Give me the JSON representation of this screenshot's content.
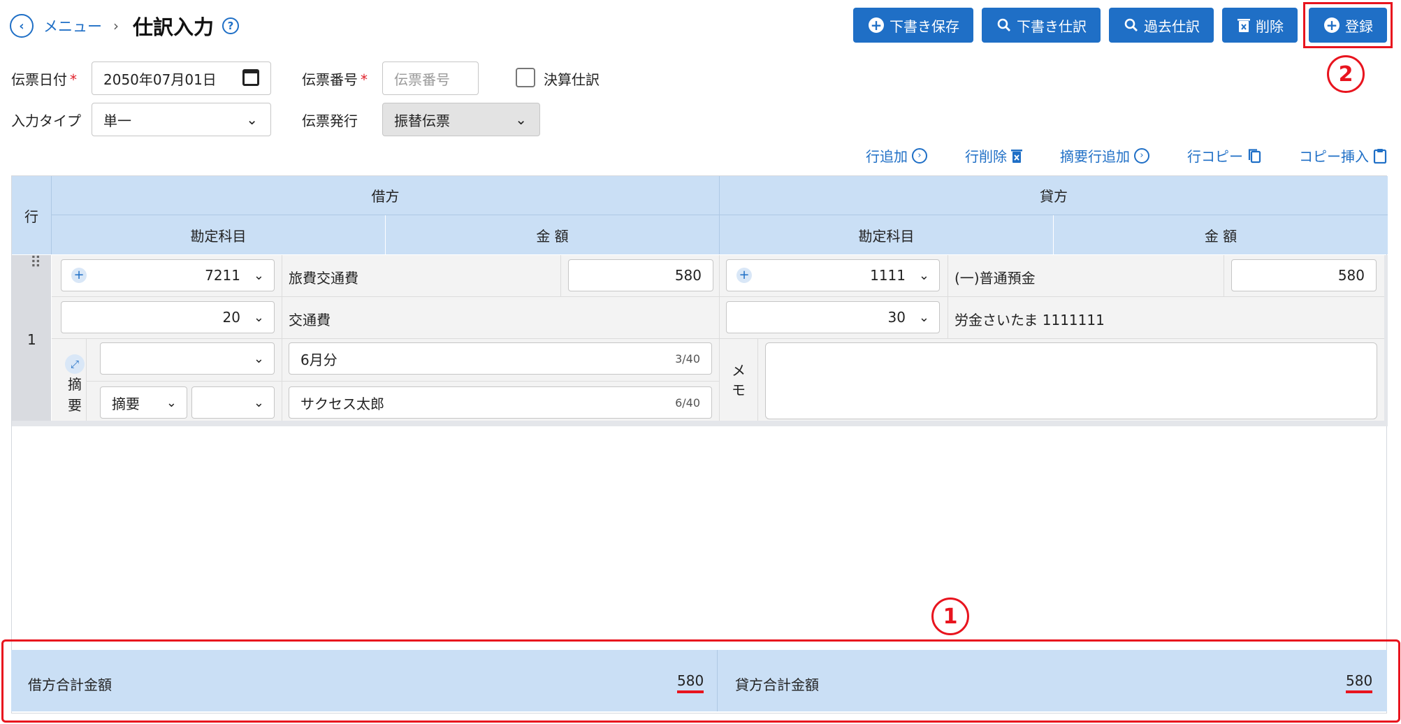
{
  "header": {
    "menu_label": "メニュー",
    "breadcrumb_sep": "›",
    "title": "仕訳入力",
    "help": "?"
  },
  "toolbar": {
    "draft_save": "下書き保存",
    "draft_journal": "下書き仕訳",
    "past_journal": "過去仕訳",
    "delete": "削除",
    "register": "登録"
  },
  "form": {
    "date_label": "伝票日付",
    "date_value": "2050年07月01日",
    "slip_no_label": "伝票番号",
    "slip_no_placeholder": "伝票番号",
    "closing_label": "決算仕訳",
    "input_type_label": "入力タイプ",
    "input_type_value": "単一",
    "issue_label": "伝票発行",
    "issue_value": "振替伝票",
    "required_mark": "*"
  },
  "row_actions": {
    "add_row": "行追加",
    "delete_row": "行削除",
    "add_summary_row": "摘要行追加",
    "copy_row": "行コピー",
    "copy_insert": "コピー挿入"
  },
  "table": {
    "row_header": "行",
    "debit_header": "借方",
    "credit_header": "貸方",
    "account_header": "勘定科目",
    "amount_header": "金 額",
    "rows": [
      {
        "row_no": "1",
        "debit_account_code": "7211",
        "debit_account_name": "旅費交通費",
        "debit_amount": "580",
        "debit_sub_code": "20",
        "debit_sub_name": "交通費",
        "credit_account_code": "1111",
        "credit_account_name": "(一)普通預金",
        "credit_amount": "580",
        "credit_sub_code": "30",
        "credit_sub_name": "労金さいたま 1111111",
        "summary_label": "摘要",
        "summary_label_alt": "摘要",
        "summary_text1": "6月分",
        "summary_count1": "3/40",
        "summary_text2": "サクセス太郎",
        "summary_count2": "6/40",
        "memo_label": "メモ"
      }
    ]
  },
  "totals": {
    "debit_label": "借方合計金額",
    "debit_value": "580",
    "credit_label": "貸方合計金額",
    "credit_value": "580"
  },
  "annotations": {
    "marker_1": "1",
    "marker_2": "2",
    "color": "#e8141e"
  },
  "colors": {
    "primary": "#1f6fc6",
    "header_bg": "#cadff5"
  }
}
